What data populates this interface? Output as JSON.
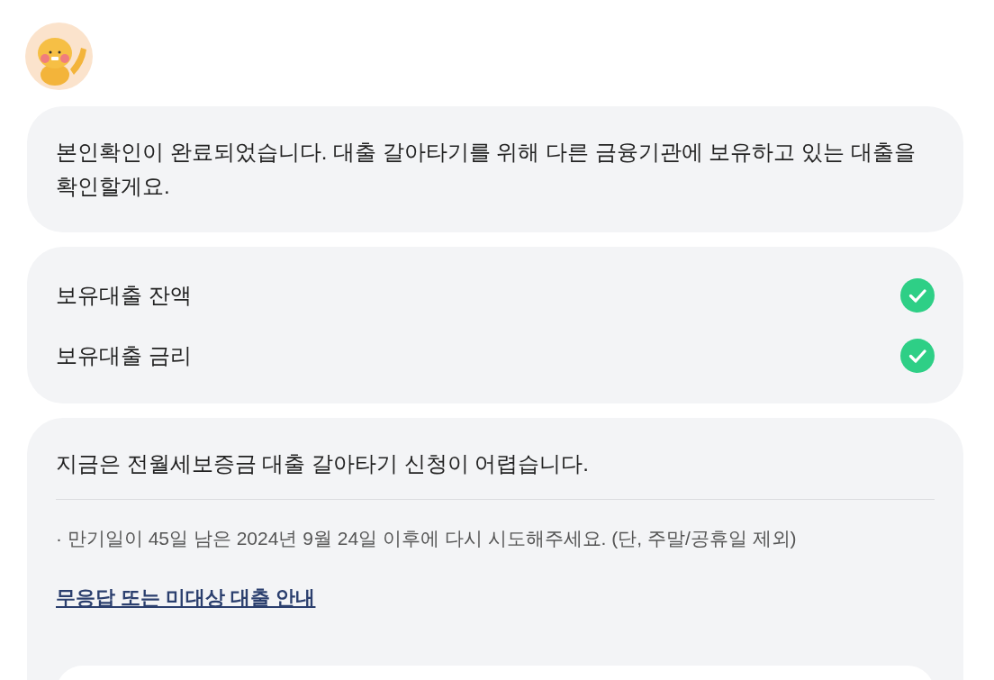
{
  "message": "본인확인이 완료되었습니다. 대출 갈아타기를 위해 다른 금융기관에 보유하고 있는 대출을 확인할게요.",
  "checklist": [
    {
      "label": "보유대출 잔액",
      "checked": true
    },
    {
      "label": "보유대출 금리",
      "checked": true
    }
  ],
  "notice": {
    "title": "지금은 전월세보증금 대출 갈아타기 신청이 어렵습니다.",
    "detail": "· 만기일이 45일 남은 2024년 9월 24일 이후에 다시 시도해주세요. (단, 주말/공휴일 제외)",
    "link": "무응답 또는 미대상 대출 안내"
  }
}
